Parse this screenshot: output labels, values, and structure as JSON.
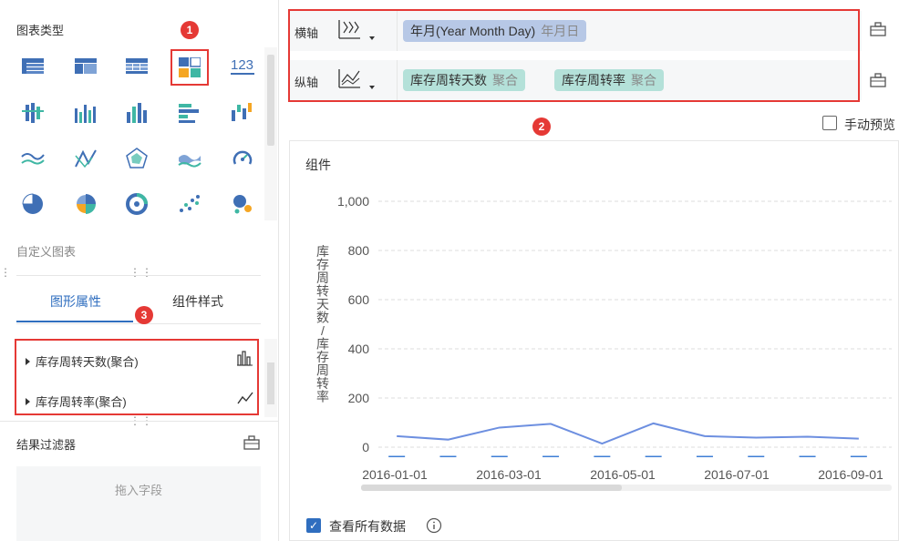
{
  "left": {
    "chart_type_title": "图表类型",
    "custom_chart_label": "自定义图表",
    "tabs": [
      {
        "label": "图形属性",
        "active": true
      },
      {
        "label": "组件样式",
        "active": false
      }
    ],
    "series": [
      {
        "label": "库存周转天数(聚合)",
        "icon": "bar-chart-icon"
      },
      {
        "label": "库存周转率(聚合)",
        "icon": "line-chart-icon"
      }
    ],
    "filter_title": "结果过滤器",
    "drop_placeholder": "拖入字段",
    "markers": [
      "1",
      "3"
    ]
  },
  "axes": {
    "x_label": "横轴",
    "y_label": "纵轴",
    "x_fields": [
      {
        "name": "年月(Year Month Day)",
        "agg": "年月日"
      }
    ],
    "y_fields": [
      {
        "name": "库存周转天数",
        "agg": "聚合"
      },
      {
        "name": "库存周转率",
        "agg": "聚合"
      }
    ],
    "marker": "2"
  },
  "preview_label": "手动预览",
  "component": {
    "title": "组件",
    "view_all_label": "查看所有数据",
    "view_all_checked": true
  },
  "chart_data": {
    "type": "bar",
    "title": "",
    "ylabel": "库存周转天数/库存周转率",
    "ylim": [
      0,
      1000
    ],
    "yticks": [
      "0",
      "200",
      "400",
      "600",
      "800",
      "1,000"
    ],
    "x_tick_labels": [
      "2016-01-01",
      "2016-03-01",
      "2016-05-01",
      "2016-07-01",
      "2016-09-01"
    ],
    "grid": true,
    "series": [
      {
        "type": "bar",
        "color": "#3f7fd6",
        "values": [
          1,
          1,
          1,
          1,
          1,
          1,
          1,
          1,
          1,
          1
        ]
      },
      {
        "type": "line",
        "color": "#6d8fe0",
        "values": [
          30,
          16,
          65,
          80,
          0,
          82,
          30,
          24,
          28,
          20
        ]
      }
    ]
  }
}
